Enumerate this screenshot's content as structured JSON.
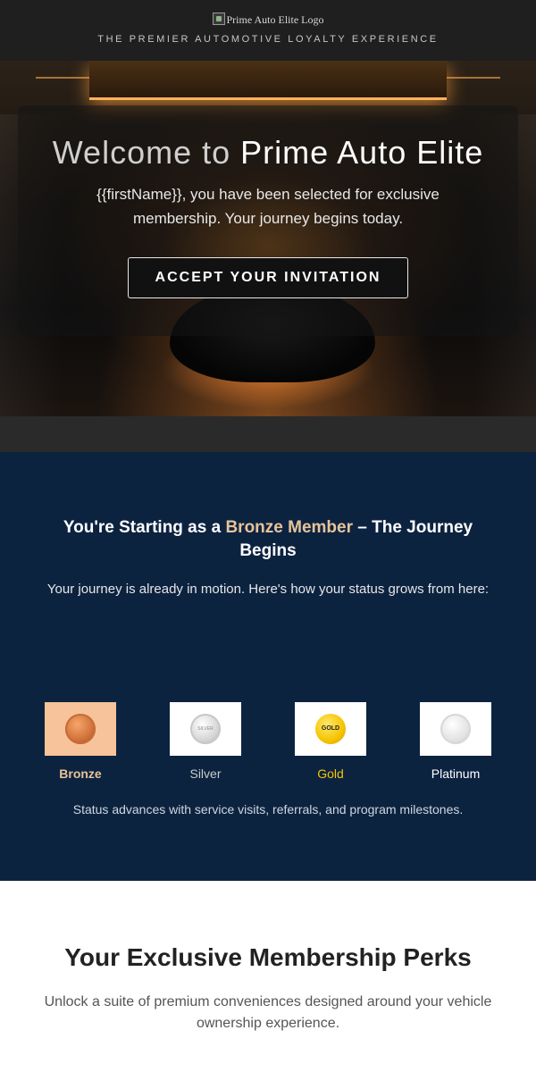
{
  "header": {
    "logo_alt": "Prime Auto Elite Logo",
    "tagline": "THE PREMIER AUTOMOTIVE LOYALTY EXPERIENCE"
  },
  "hero": {
    "welcome_prefix": "Welcome to",
    "brand": "Prime Auto Elite",
    "subtitle": "{{firstName}}, you have been selected for exclusive membership. Your journey begins today.",
    "cta_label": "ACCEPT YOUR INVITATION"
  },
  "status": {
    "heading_prefix": "You're Starting as a",
    "heading_accent": "Bronze Member",
    "heading_suffix": "– The Journey Begins",
    "description": "Your journey is already in motion. Here's how your status grows from here:",
    "tiers": [
      {
        "name": "Bronze",
        "coin_text": ""
      },
      {
        "name": "Silver",
        "coin_text": "SILVER"
      },
      {
        "name": "Gold",
        "coin_text": "GOLD"
      },
      {
        "name": "Platinum",
        "coin_text": ""
      }
    ],
    "note": "Status advances with service visits, referrals, and program milestones."
  },
  "perks": {
    "heading": "Your Exclusive Membership Perks",
    "description": "Unlock a suite of premium conveniences designed around your vehicle ownership experience.",
    "icons": [
      "gift-icon",
      "ribbon-icon"
    ]
  },
  "colors": {
    "header_bg": "#1f1f1f",
    "status_bg": "#0c2340",
    "bronze_accent": "#e7c39a",
    "gold_accent": "#f5c400"
  }
}
